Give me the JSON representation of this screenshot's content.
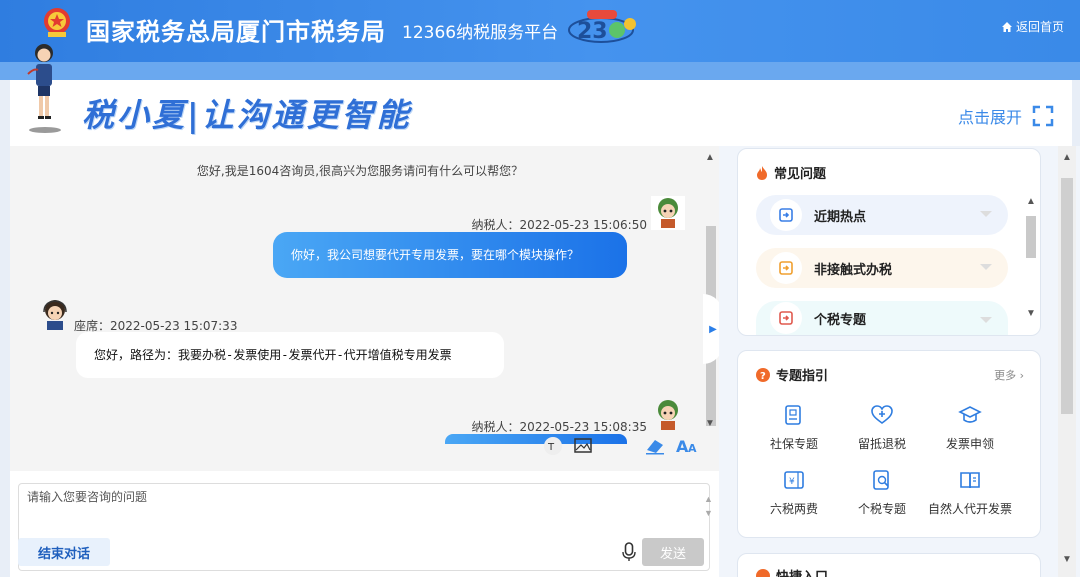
{
  "header": {
    "org_title": "国家税务总局厦门市税务局",
    "platform_title": "12366纳税服务平台",
    "home_label": "返回首页"
  },
  "banner": {
    "slogan": "税小夏|让沟通更智能",
    "expand_label": "点击展开"
  },
  "chat": {
    "greeting": "您好,我是1604咨询员,很高兴为您服务请问有什么可以帮您？",
    "messages": [
      {
        "meta": "纳税人：2022-05-23 15:06:50",
        "text": "你好，我公司想要代开专用发票，要在哪个模块操作？"
      },
      {
        "meta": "座席：2022-05-23 15:07:33",
        "text": "您好，路径为：我要办税-发票使用-发票代开-代开增值税专用发票"
      },
      {
        "meta": "纳税人：2022-05-23 15:08:35",
        "text": ""
      }
    ]
  },
  "input": {
    "placeholder": "请输入您要咨询的问题",
    "end_label": "结束对话",
    "send_label": "发送"
  },
  "faq": {
    "title": "常见问题",
    "items": [
      {
        "label": "近期热点",
        "bg": "#eef3fc",
        "icon_color": "#3a7fe6"
      },
      {
        "label": "非接触式办税",
        "bg": "#fdf6ec",
        "icon_color": "#f0a030"
      },
      {
        "label": "个税专题",
        "bg": "#eefafb",
        "icon_color": "#e05a4f"
      }
    ]
  },
  "guide": {
    "title": "专题指引",
    "more_label": "更多",
    "items": [
      {
        "label": "社保专题",
        "icon": "social-security-icon"
      },
      {
        "label": "留抵退税",
        "icon": "heart-plus-icon"
      },
      {
        "label": "发票申领",
        "icon": "graduation-cap-icon"
      },
      {
        "label": "六税两费",
        "icon": "tax-document-icon"
      },
      {
        "label": "个税专题",
        "icon": "tax-search-icon"
      },
      {
        "label": "自然人代开发票",
        "icon": "open-book-icon"
      }
    ]
  },
  "shortcut": {
    "title": "快捷入口"
  },
  "colors": {
    "header_blue": "#2f7de0",
    "accent_blue": "#1b72e8",
    "user_bubble_start": "#4aa7f5"
  }
}
